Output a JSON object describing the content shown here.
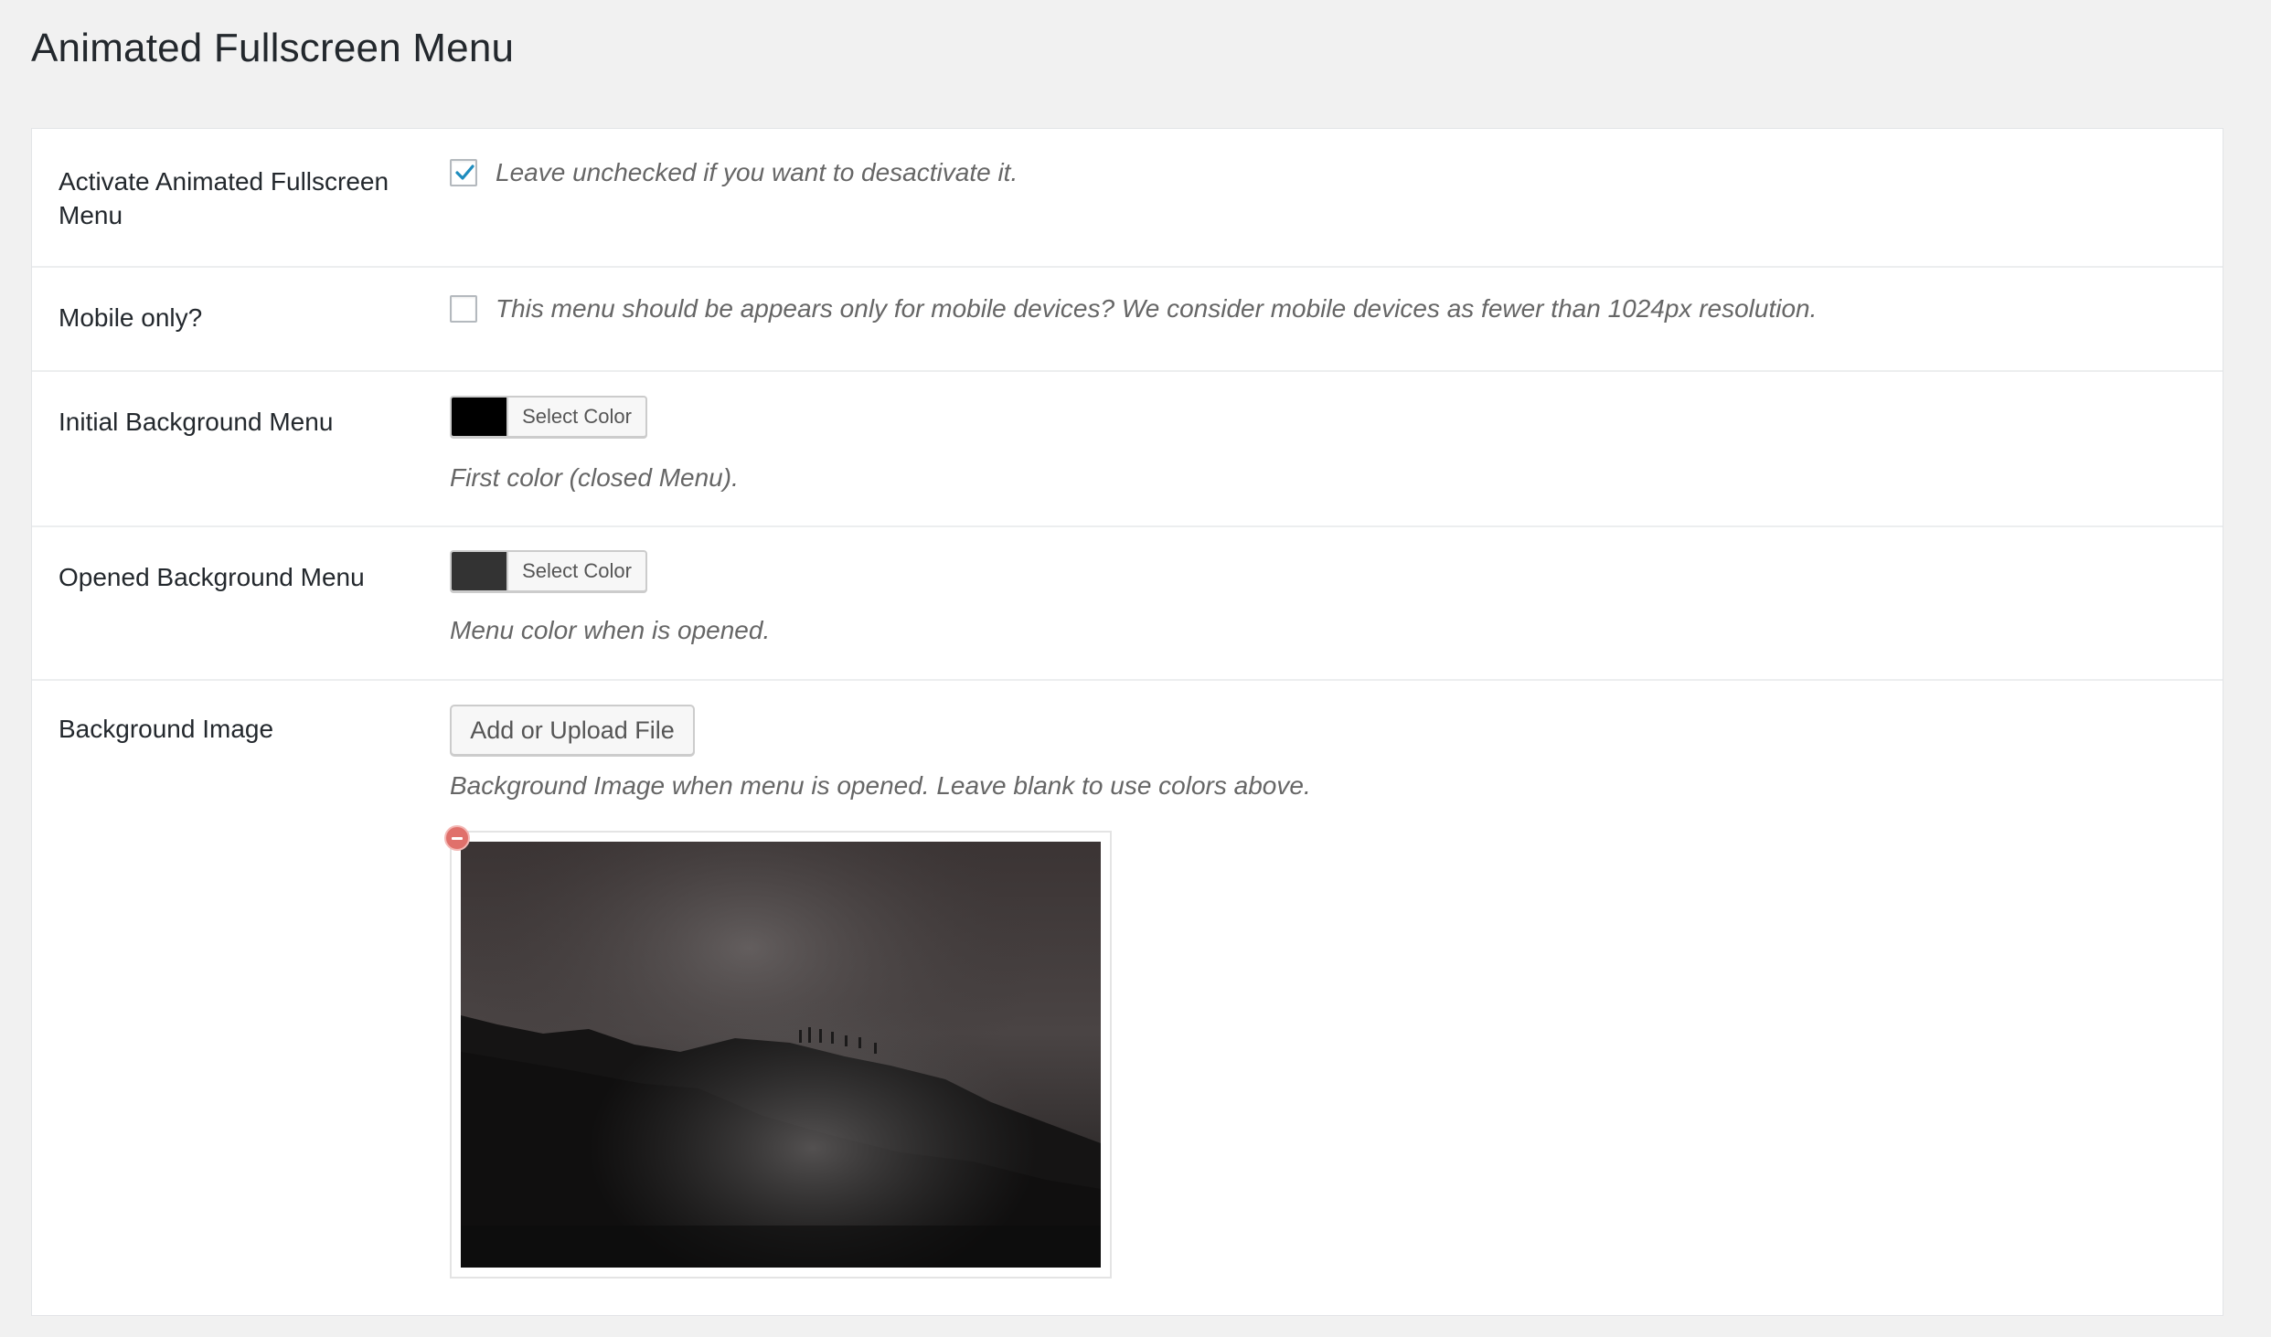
{
  "page": {
    "title": "Animated Fullscreen Menu"
  },
  "rows": {
    "activate": {
      "label": "Activate Animated Fullscreen Menu",
      "checked": true,
      "description": "Leave unchecked if you want to desactivate it."
    },
    "mobile": {
      "label": "Mobile only?",
      "checked": false,
      "description": "This menu should be appears only for mobile devices? We consider mobile devices as fewer than 1024px resolution."
    },
    "initial_bg": {
      "label": "Initial Background Menu",
      "button_label": "Select Color",
      "color": "#000000",
      "description": "First color (closed Menu)."
    },
    "opened_bg": {
      "label": "Opened Background Menu",
      "button_label": "Select Color",
      "color": "#333333",
      "description": "Menu color when is opened."
    },
    "bg_image": {
      "label": "Background Image",
      "button_label": "Add or Upload File",
      "description": "Background Image when menu is opened. Leave blank to use colors above."
    }
  },
  "colors": {
    "accent": "#1e8cbe",
    "remove": "#e0706b"
  }
}
